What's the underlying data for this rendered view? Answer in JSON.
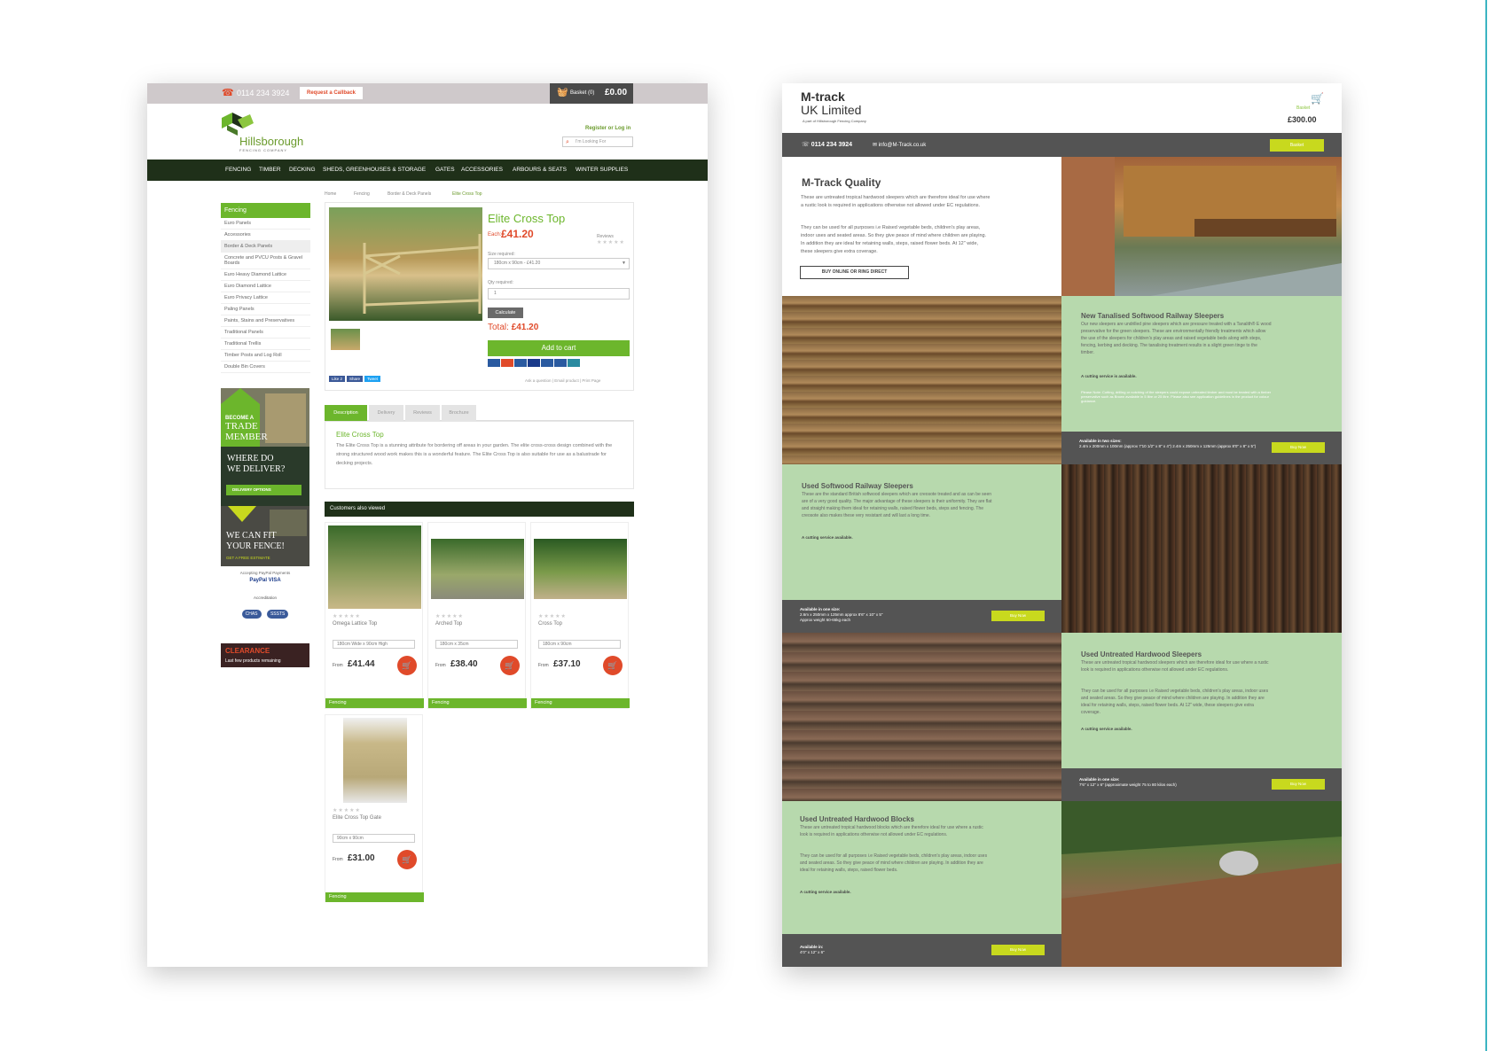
{
  "hillsborough": {
    "topbar": {
      "phone": "0114 234 3924",
      "callback": "Request a Callback",
      "basket_label": "Basket (0)",
      "basket_price": "£0.00"
    },
    "logo": {
      "name": "Hillsborough",
      "sub": "FENCING COMPANY"
    },
    "register": "Register or Log in",
    "search_placeholder": "I'm Looking For",
    "nav": [
      "FENCING",
      "TIMBER",
      "DECKING",
      "SHEDS, GREENHOUSES & STORAGE",
      "GATES",
      "ACCESSORIES",
      "ARBOURS & SEATS",
      "WINTER SUPPLIES"
    ],
    "breadcrumb": [
      "Home",
      "Fencing",
      "Border & Deck Panels",
      "Elite Cross Top"
    ],
    "sidebar": {
      "heading": "Fencing",
      "items": [
        "Euro Panels",
        "Accessories",
        "Border & Deck Panels",
        "Concrete and PVCU Posts & Gravel Boards",
        "Euro Heavy Diamond Lattice",
        "Euro Diamond Lattice",
        "Euro Privacy Lattice",
        "Paling Panels",
        "Paints, Stains and Preservatives",
        "Traditional Panels",
        "Traditional Trellis",
        "Timber Posts and Log Roll",
        "Double Bin Covers"
      ]
    },
    "banners": {
      "trade_1": "BECOME A",
      "trade_2": "TRADE",
      "trade_3": "MEMBER",
      "deliver_1": "WHERE DO",
      "deliver_2": "WE DELIVER?",
      "deliver_btn": "DELIVERY OPTIONS",
      "fit_1": "WE CAN FIT",
      "fit_2": "YOUR FENCE!",
      "fit_sub": "GET A FREE ESTIMATE",
      "clear_1": "CLEARANCE",
      "clear_2": "Last few products remaining"
    },
    "payments": {
      "label": "Accepting PayPal Payments",
      "row": "PayPal VISA"
    },
    "accreditation": {
      "label": "Accreditation",
      "chips": [
        "CHAS",
        "SSSTS"
      ]
    },
    "product": {
      "name": "Elite Cross Top",
      "each_label": "Each:",
      "price": "£41.20",
      "reviews": "Reviews",
      "stars": "★★★★★",
      "size_label": "Size required:",
      "size_value": "180cm x 90cm - £41.20",
      "qty_label": "Qty required:",
      "qty_value": "1",
      "calc": "Calculate",
      "total_label": "Total:",
      "total": "£41.20",
      "add": "Add to cart",
      "links": "Ask a question | Email product | Print Page",
      "social": [
        "Like 2",
        "Share",
        "Tweet"
      ]
    },
    "tabs": [
      "Description",
      "Delivery",
      "Reviews",
      "Brochure"
    ],
    "description": {
      "title": "Elite Cross Top",
      "text": "The Elite Cross Top is a stunning attribute for bordering off areas in your garden. The elite cross-cross design combined with the strong structured wood work makes this is a wonderful feature. The Elite Cross Top is also suitable for use as a balustrade for decking projects."
    },
    "also_viewed": {
      "heading": "Customers also viewed",
      "items": [
        {
          "name": "Omega Lattice Top",
          "size": "180cm Wide x 90cm High",
          "from": "From",
          "price": "£41.44",
          "cat": "Fencing"
        },
        {
          "name": "Arched Top",
          "size": "180cm x 35cm",
          "from": "From",
          "price": "£38.40",
          "cat": "Fencing"
        },
        {
          "name": "Cross Top",
          "size": "180cm x 90cm",
          "from": "From",
          "price": "£37.10",
          "cat": "Fencing"
        },
        {
          "name": "Elite Cross Top Gate",
          "size": "90cm x 90cm",
          "from": "From",
          "price": "£31.00",
          "cat": "Fencing"
        }
      ]
    }
  },
  "mtrack": {
    "logo_1": "M-track",
    "logo_2": "UK Limited",
    "logo_3": "A part of Hillsborough Fencing Company",
    "cart_basket": "Basket",
    "cart_total": "£300.00",
    "bar": {
      "phone": "0114 234 3924",
      "email": "info@M-Track.co.uk",
      "basket": "Basket"
    },
    "quality": {
      "title": "M-Track Quality",
      "p1": "These are untreated tropical hardwood sleepers which are therefore ideal for use where a rustic look is required in applications otherwise not allowed under EC regulations.",
      "p2": "They can be used for all purposes i.e Raised vegetable beds, children's play areas, indoor uses and seated areas. So they give peace of mind where children are playing. In addition they are ideal for retaining walls, steps, raised flower beds. At 12\" wide, these sleepers give extra coverage.",
      "button": "BUY ONLINE OR RING DIRECT"
    },
    "new_tanalised": {
      "title": "New Tanalised Softwood Railway Sleepers",
      "text": "Our new sleepers are undrilled pine sleepers which are pressure treated with a Tanalith® E wood preservative for the green sleepers. These are environmentally friendly treatments which allow the use of the sleepers for children's play areas and raised vegetable beds along with steps, fencing, kerbing and decking. The tanalising treatment results in a slight green tinge to the timber.",
      "cutting": "A cutting service is available.",
      "note": "Please Note: Cutting, drilling or notching of the sleepers could expose untreated timber and must be treated with a timber preservative such as Brown available in 5 litre or 25 litre. Please also see application guidelines in the product for colour guidance.",
      "avail": "Available in two sizes:",
      "sizes": "2.4m x 200mm x 100mm (approx 7'10 1/2\" x 8\" x 4\")  2.4m x 250mm x 125mm (approx 8'0\" x 8\" x 5\")",
      "buy": "Buy Now"
    },
    "used_softwood": {
      "title": "Used Softwood Railway Sleepers",
      "text": "These are the standard British softwood sleepers which are creosote treated and as can be seen are of a very good quality. The major advantage of these sleepers is their uniformity. They are flat and straight making them ideal for retaining walls, raised flower beds, steps and fencing. The creosote also makes these very resistant and will last a long time.",
      "cutting": "A cutting service available.",
      "avail": "Available in one size:",
      "size": "2.6m x 250mm x 125mm approx 8'6\" x 10\" x 5\"",
      "weight": "Approx weight 60-65kg each",
      "buy": "Buy Now"
    },
    "used_hardwood": {
      "title": "Used Untreated Hardwood Sleepers",
      "p1": "These are untreated tropical hardwood sleepers which are therefore ideal for use where a rustic look is required in applications otherwise not allowed under EC regulations.",
      "p2": "They can be used for all purposes i.e Raised vegetable beds, children's play areas, indoor uses and seated areas. So they give peace of mind where children are playing. In addition they are ideal for retaining walls, steps, raised flower beds. At 12\" wide, these sleepers give extra coverage.",
      "cutting": "A cutting service available.",
      "avail": "Available in one size:",
      "size": "7'6\" x 12\" x 6\" (approximate weight 75 to 80 kilos each)",
      "buy": "Buy Now"
    },
    "hardwood_blocks": {
      "title": "Used Untreated Hardwood Blocks",
      "p1": "These are untreated tropical hardwood blocks which are therefore ideal for use where a rustic look is required in applications otherwise not allowed under EC regulations.",
      "p2": "They can be used for all purposes i.e Raised vegetable beds, children's play areas, indoor uses and seated areas. So they give peace of mind where children are playing. In addition they are ideal for retaining walls, steps, raised flower beds.",
      "cutting": "A cutting service available.",
      "avail": "Available in:",
      "size": "4'0\" x 12\" x 6\"",
      "buy": "Buy Now"
    }
  }
}
